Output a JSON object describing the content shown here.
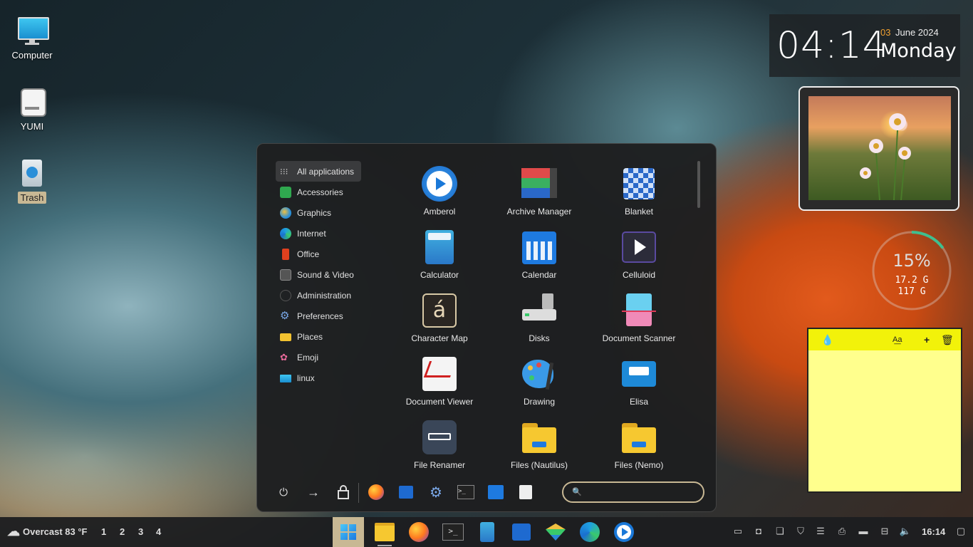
{
  "desktop": {
    "icons": [
      {
        "label": "Computer"
      },
      {
        "label": "YUMI"
      },
      {
        "label": "Trash"
      }
    ]
  },
  "clock": {
    "time": "04:14",
    "day": "03",
    "month_year": "June 2024",
    "weekday": "Monday",
    "accent": "#f0a030"
  },
  "disk": {
    "percent_label": "15%",
    "used": "17.2 G",
    "total": "117 G",
    "fraction": 0.15,
    "accent": "#3fbf8f"
  },
  "note": {
    "color": "#ffff8d"
  },
  "menu": {
    "categories": [
      {
        "label": "All applications",
        "icon": "grid-icon"
      },
      {
        "label": "Accessories",
        "icon": "accessories-icon"
      },
      {
        "label": "Graphics",
        "icon": "graphics-icon"
      },
      {
        "label": "Internet",
        "icon": "internet-icon"
      },
      {
        "label": "Office",
        "icon": "office-icon"
      },
      {
        "label": "Sound & Video",
        "icon": "sound-video-icon"
      },
      {
        "label": "Administration",
        "icon": "administration-icon"
      },
      {
        "label": "Preferences",
        "icon": "preferences-icon"
      },
      {
        "label": "Places",
        "icon": "folder-icon"
      },
      {
        "label": "Emoji",
        "icon": "emoji-icon"
      },
      {
        "label": "linux",
        "icon": "monitor-icon"
      }
    ],
    "apps": [
      {
        "label": "Amberol"
      },
      {
        "label": "Archive Manager"
      },
      {
        "label": "Blanket"
      },
      {
        "label": "Calculator"
      },
      {
        "label": "Calendar"
      },
      {
        "label": "Celluloid"
      },
      {
        "label": "Character Map"
      },
      {
        "label": "Disks"
      },
      {
        "label": "Document Scanner"
      },
      {
        "label": "Document Viewer"
      },
      {
        "label": "Drawing"
      },
      {
        "label": "Elisa"
      },
      {
        "label": "File Renamer"
      },
      {
        "label": "Files (Nautilus)"
      },
      {
        "label": "Files (Nemo)"
      }
    ],
    "search_value": ""
  },
  "taskbar": {
    "weather": "Overcast 83 °F",
    "workspaces": [
      "1",
      "2",
      "3",
      "4"
    ],
    "time": "16:14"
  }
}
